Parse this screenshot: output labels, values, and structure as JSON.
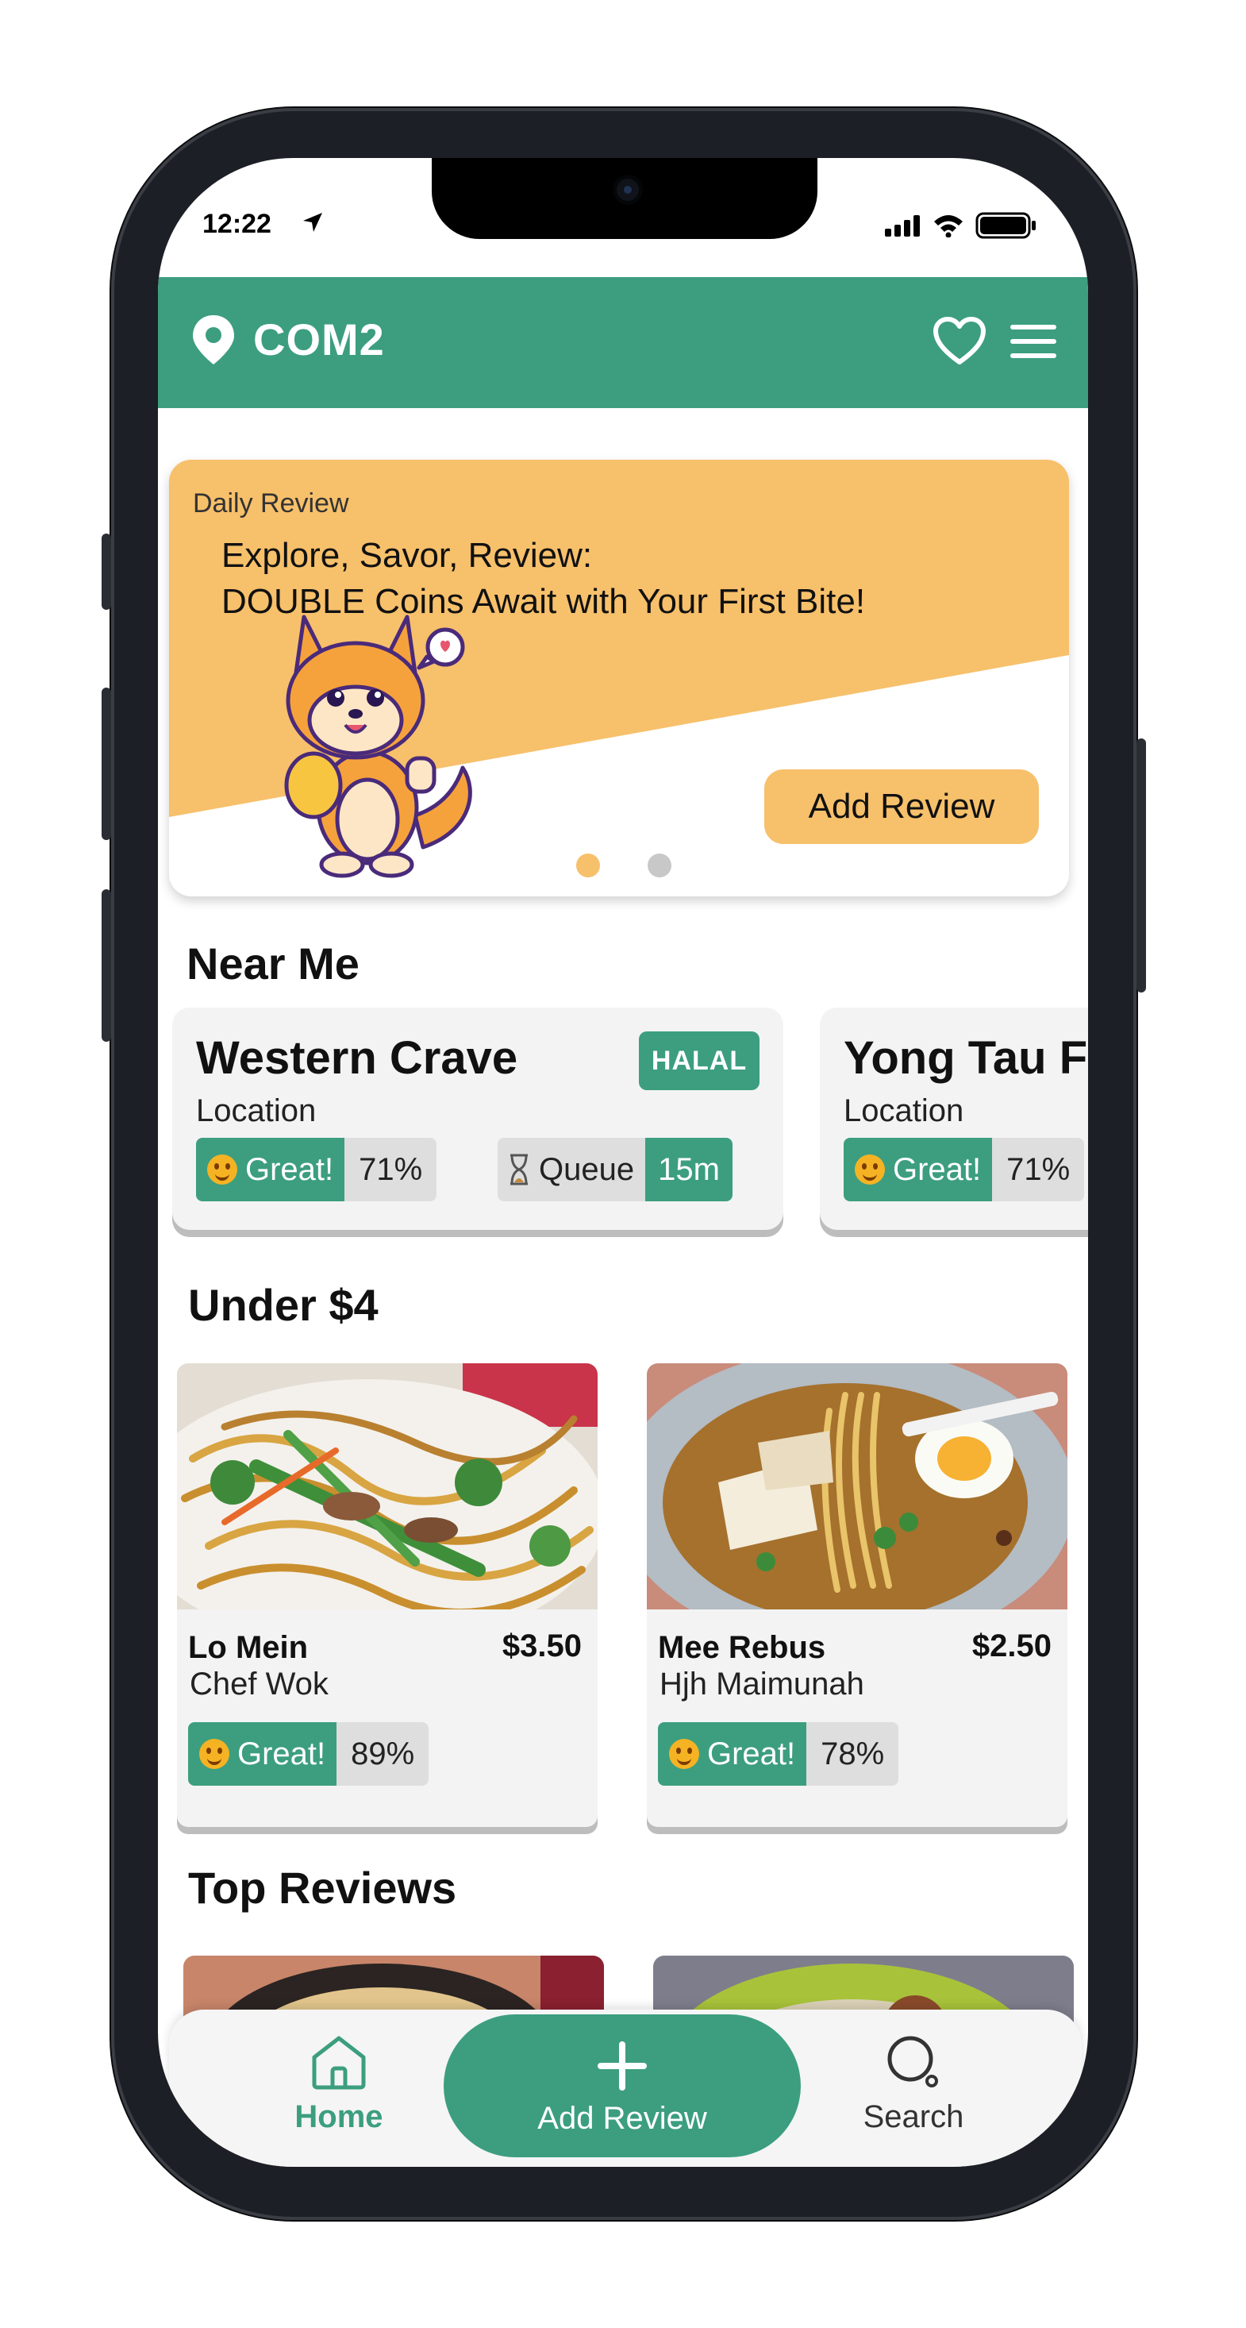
{
  "status_bar": {
    "time": "12:22"
  },
  "header": {
    "location": "COM2"
  },
  "promo": {
    "label": "Daily Review",
    "line1": "Explore, Savor, Review:",
    "line2": "DOUBLE Coins Await with Your First Bite!",
    "button": "Add Review",
    "active_slide": 1,
    "slide_count": 2,
    "colors": {
      "accent": "#f7c06b",
      "inactive_dot": "#c8c8c8"
    }
  },
  "near_me": {
    "title": "Near Me",
    "cards": [
      {
        "name": "Western Crave",
        "location": "Location",
        "halal": "HALAL",
        "rating_label": "Great!",
        "rating_pct": "71%",
        "queue_label": "Queue",
        "queue_time": "15m"
      },
      {
        "name": "Yong Tau Foo",
        "location": "Location",
        "rating_label": "Great!",
        "rating_pct": "71%"
      }
    ]
  },
  "under4": {
    "title": "Under $4",
    "items": [
      {
        "name": "Lo Mein",
        "price": "$3.50",
        "vendor": "Chef Wok",
        "rating_label": "Great!",
        "rating_pct": "89%"
      },
      {
        "name": "Mee Rebus",
        "price": "$2.50",
        "vendor": "Hjh Maimunah",
        "rating_label": "Great!",
        "rating_pct": "78%"
      }
    ]
  },
  "top_reviews": {
    "title": "Top Reviews"
  },
  "bottom_nav": {
    "home": "Home",
    "add_review": "Add Review",
    "search": "Search"
  },
  "colors": {
    "brand": "#3c9e7f",
    "card": "#f3f3f3",
    "pill_grey": "#dedede"
  }
}
